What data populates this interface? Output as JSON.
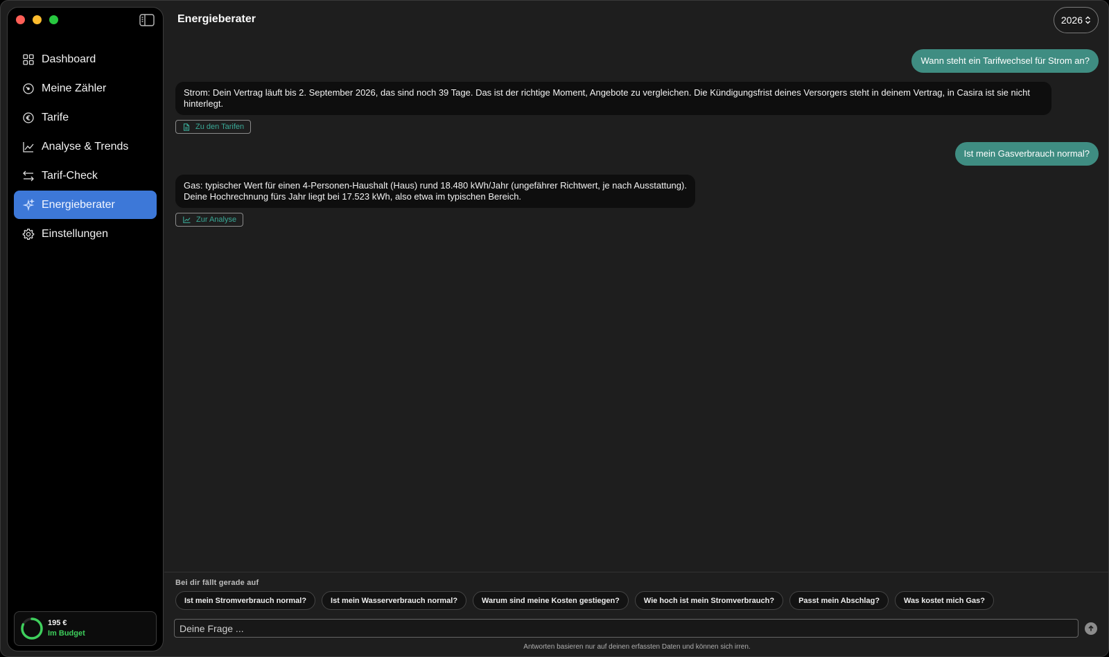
{
  "sidebar": {
    "items": [
      {
        "label": "Dashboard",
        "icon": "grid-icon",
        "active": false
      },
      {
        "label": "Meine Zähler",
        "icon": "gauge-icon",
        "active": false
      },
      {
        "label": "Tarife",
        "icon": "euro-circle-icon",
        "active": false
      },
      {
        "label": "Analyse & Trends",
        "icon": "line-chart-icon",
        "active": false
      },
      {
        "label": "Tarif-Check",
        "icon": "arrows-swap-icon",
        "active": false
      },
      {
        "label": "Energieberater",
        "icon": "sparkle-icon",
        "active": true
      },
      {
        "label": "Einstellungen",
        "icon": "gear-icon",
        "active": false
      }
    ],
    "budget": {
      "amount": "195 €",
      "status": "Im Budget",
      "progress": 0.82
    }
  },
  "header": {
    "title": "Energieberater",
    "year": "2026"
  },
  "chat": {
    "messages": [
      {
        "role": "user",
        "text": "Wann steht ein Tarifwechsel für Strom an?"
      },
      {
        "role": "assistant",
        "text": "Strom: Dein Vertrag läuft bis 2. September 2026, das sind noch 39 Tage. Das ist der richtige Moment, Angebote zu vergleichen. Die Kündigungsfrist deines Versorgers steht in deinem Vertrag, in Casira ist sie nicht hinterlegt.",
        "action": "Zu den Tarifen"
      },
      {
        "role": "user",
        "text": "Ist mein Gasverbrauch normal?"
      },
      {
        "role": "assistant",
        "line1": "Gas: typischer Wert für einen 4-Personen-Haushalt (Haus) rund 18.480 kWh/Jahr (ungefährer Richtwert, je nach Ausstattung).",
        "line2": "Deine Hochrechnung fürs Jahr liegt bei 17.523 kWh, also etwa im typischen Bereich.",
        "action": "Zur Analyse"
      }
    ]
  },
  "suggestions": {
    "label": "Bei dir fällt gerade auf",
    "chips": [
      "Ist mein Stromverbrauch normal?",
      "Ist mein Wasserverbrauch normal?",
      "Warum sind meine Kosten gestiegen?",
      "Wie hoch ist mein Stromverbrauch?",
      "Passt mein Abschlag?",
      "Was kostet mich Gas?"
    ]
  },
  "composer": {
    "placeholder": "Deine Frage ...",
    "disclaimer": "Antworten basieren nur auf deinen erfassten Daten und können sich irren."
  },
  "colors": {
    "accent": "#3d78d8",
    "user_bubble": "#3f8d82",
    "budget_ok": "#3ecf5c"
  }
}
